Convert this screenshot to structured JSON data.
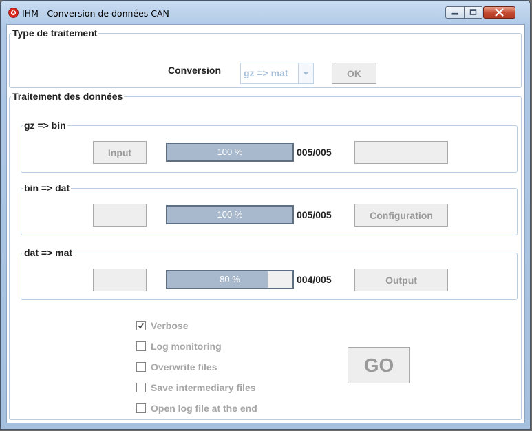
{
  "window": {
    "title": "IHM - Conversion de données CAN",
    "controls": [
      "minimize-icon",
      "maximize-icon",
      "close-icon"
    ]
  },
  "type_traitement": {
    "legend": "Type de traitement",
    "conversion_label": "Conversion",
    "conversion_value": "gz => mat",
    "ok_label": "OK"
  },
  "traitement": {
    "legend": "Traitement des données",
    "stages": [
      {
        "legend": "gz => bin",
        "left_button": "Input",
        "progress": 100,
        "progress_text": "100 %",
        "count": "005/005",
        "right_button": ""
      },
      {
        "legend": "bin => dat",
        "left_button": "",
        "progress": 100,
        "progress_text": "100 %",
        "count": "005/005",
        "right_button": "Configuration"
      },
      {
        "legend": "dat => mat",
        "left_button": "",
        "progress": 80,
        "progress_text": "80 %",
        "count": "004/005",
        "right_button": "Output"
      }
    ]
  },
  "options": [
    {
      "label": "Verbose",
      "checked": true
    },
    {
      "label": "Log monitoring",
      "checked": false
    },
    {
      "label": "Overwrite files",
      "checked": false
    },
    {
      "label": "Save intermediary files",
      "checked": false
    },
    {
      "label": "Open log file at the end",
      "checked": false
    }
  ],
  "go_label": "GO",
  "colors": {
    "progress_fill": "#a8b9cd",
    "disabled_text": "#9a9a9a",
    "title_bar": "#c9dcf1"
  }
}
